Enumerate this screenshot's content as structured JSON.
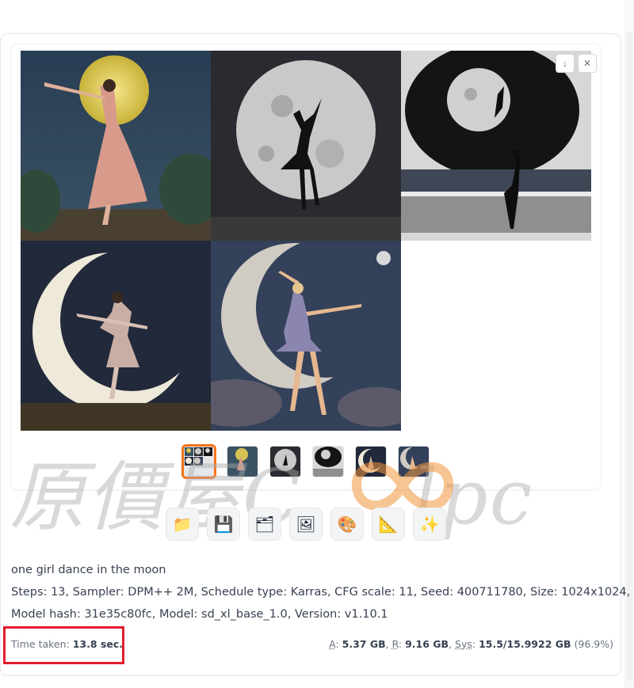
{
  "gallery": {
    "images": [
      {
        "name": "image-1",
        "alt_icon": "girl-dancing-full-moon"
      },
      {
        "name": "image-2",
        "alt_icon": "silhouette-dancer-moon"
      },
      {
        "name": "image-3",
        "alt_icon": "silhouette-moon-lake"
      },
      {
        "name": "image-4",
        "alt_icon": "dancer-crescent-moon"
      },
      {
        "name": "image-5",
        "alt_icon": "ballerina-crescent-moon"
      }
    ],
    "download_icon": "↓",
    "close_icon": "✕",
    "selected_thumb_index": 0
  },
  "actions": [
    {
      "name": "open-folder-button",
      "icon": "📁"
    },
    {
      "name": "save-button",
      "icon": "💾"
    },
    {
      "name": "save-zip-button",
      "icon": "🗂"
    },
    {
      "name": "send-to-img2img-button",
      "icon": "🖼"
    },
    {
      "name": "send-to-inpaint-button",
      "icon": "🎨"
    },
    {
      "name": "send-to-extras-button",
      "icon": "📐"
    },
    {
      "name": "upscale-button",
      "icon": "✨"
    }
  ],
  "info": {
    "prompt": "one girl dance in the moon",
    "params_line1": "Steps: 13, Sampler: DPM++ 2M, Schedule type: Karras, CFG scale: 11, Seed: 400711780, Size: 1024x1024,",
    "params_line2": "Model hash: 31e35c80fc, Model: sd_xl_base_1.0, Version: v1.10.1"
  },
  "perf": {
    "time_label": "Time taken: ",
    "time_value": "13.8 sec.",
    "a_label": "A",
    "a_value": "5.37 GB",
    "r_label": "R",
    "r_value": "9.16 GB",
    "sys_label": "Sys",
    "sys_value": "15.5/15.9922 GB",
    "sys_pct": "(96.9%)"
  },
  "watermark": {
    "text": "原價屋C",
    "text2": "lpc"
  },
  "colors": {
    "highlight": "#e11d2e",
    "selected_thumb": "#f97316"
  }
}
